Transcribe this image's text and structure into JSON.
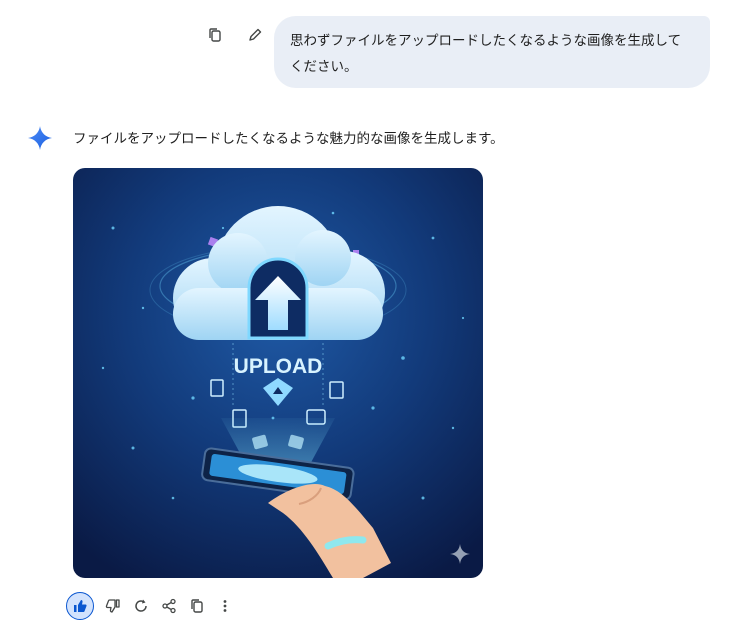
{
  "user_message": {
    "text": "思わずファイルをアップロードしたくなるような画像を生成してください。",
    "actions": [
      "copy-icon",
      "edit-icon"
    ]
  },
  "assistant": {
    "icon": "sparkle-icon",
    "text": "ファイルをアップロードしたくなるような魅力的な画像を生成します。",
    "image": {
      "overlay_text": "UPLOAD",
      "watermark": "sparkle-watermark",
      "colors": {
        "background": "#0b1d4f",
        "accent": "#4fc3f7",
        "cloud": "#bfe6fb"
      }
    }
  },
  "feedback": {
    "buttons": [
      "thumb-up-icon",
      "thumb-down-icon",
      "regenerate-icon",
      "share-icon",
      "copy-icon",
      "more-vert-icon"
    ],
    "active": "thumb-up-icon",
    "active_color": "#0b57d0"
  }
}
